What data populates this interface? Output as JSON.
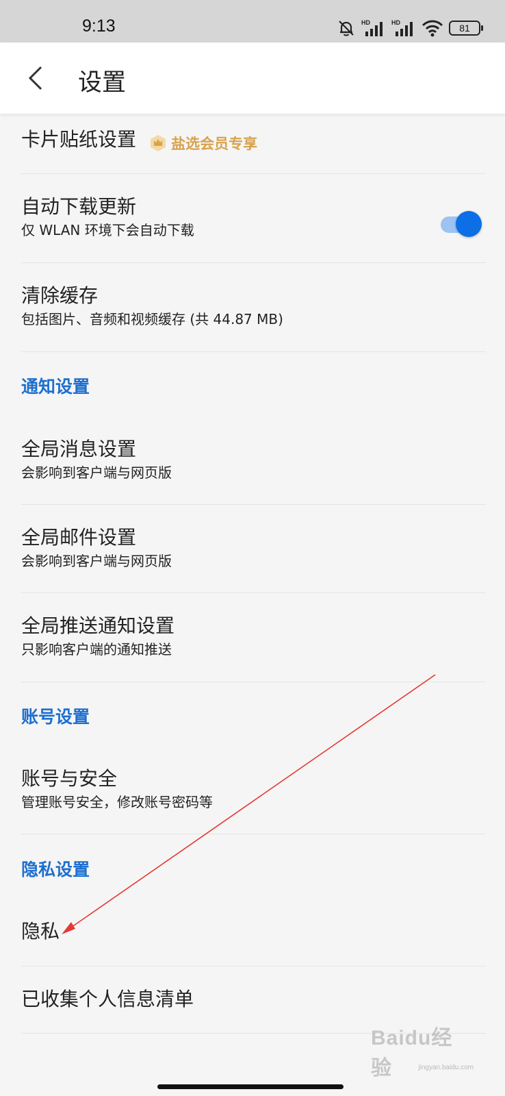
{
  "status": {
    "time": "9:13",
    "battery": "81"
  },
  "header": {
    "title": "设置"
  },
  "rows": {
    "card_sticker": {
      "title": "卡片贴纸设置",
      "badge": "盐选会员专享"
    },
    "auto_update": {
      "title": "自动下载更新",
      "subtitle": "仅 WLAN 环境下会自动下载",
      "enabled": true
    },
    "clear_cache": {
      "title": "清除缓存",
      "subtitle": "包括图片、音频和视频缓存 (共 44.87 MB)"
    },
    "global_message": {
      "title": "全局消息设置",
      "subtitle": "会影响到客户端与网页版"
    },
    "global_mail": {
      "title": "全局邮件设置",
      "subtitle": "会影响到客户端与网页版"
    },
    "global_push": {
      "title": "全局推送通知设置",
      "subtitle": "只影响客户端的通知推送"
    },
    "account_security": {
      "title": "账号与安全",
      "subtitle": "管理账号安全，修改账号密码等"
    },
    "privacy": {
      "title": "隐私"
    },
    "personal_info": {
      "title": "已收集个人信息清单"
    }
  },
  "sections": {
    "notification": "通知设置",
    "account": "账号设置",
    "privacy": "隐私设置"
  },
  "watermark": {
    "text": "Baidu经验",
    "sub": "jingyan.baidu.com"
  },
  "colors": {
    "accent_blue": "#1d6fcf",
    "toggle_on": "#0d6fe6",
    "badge_gold": "#d8a24c",
    "annotation_arrow": "#e53935"
  }
}
